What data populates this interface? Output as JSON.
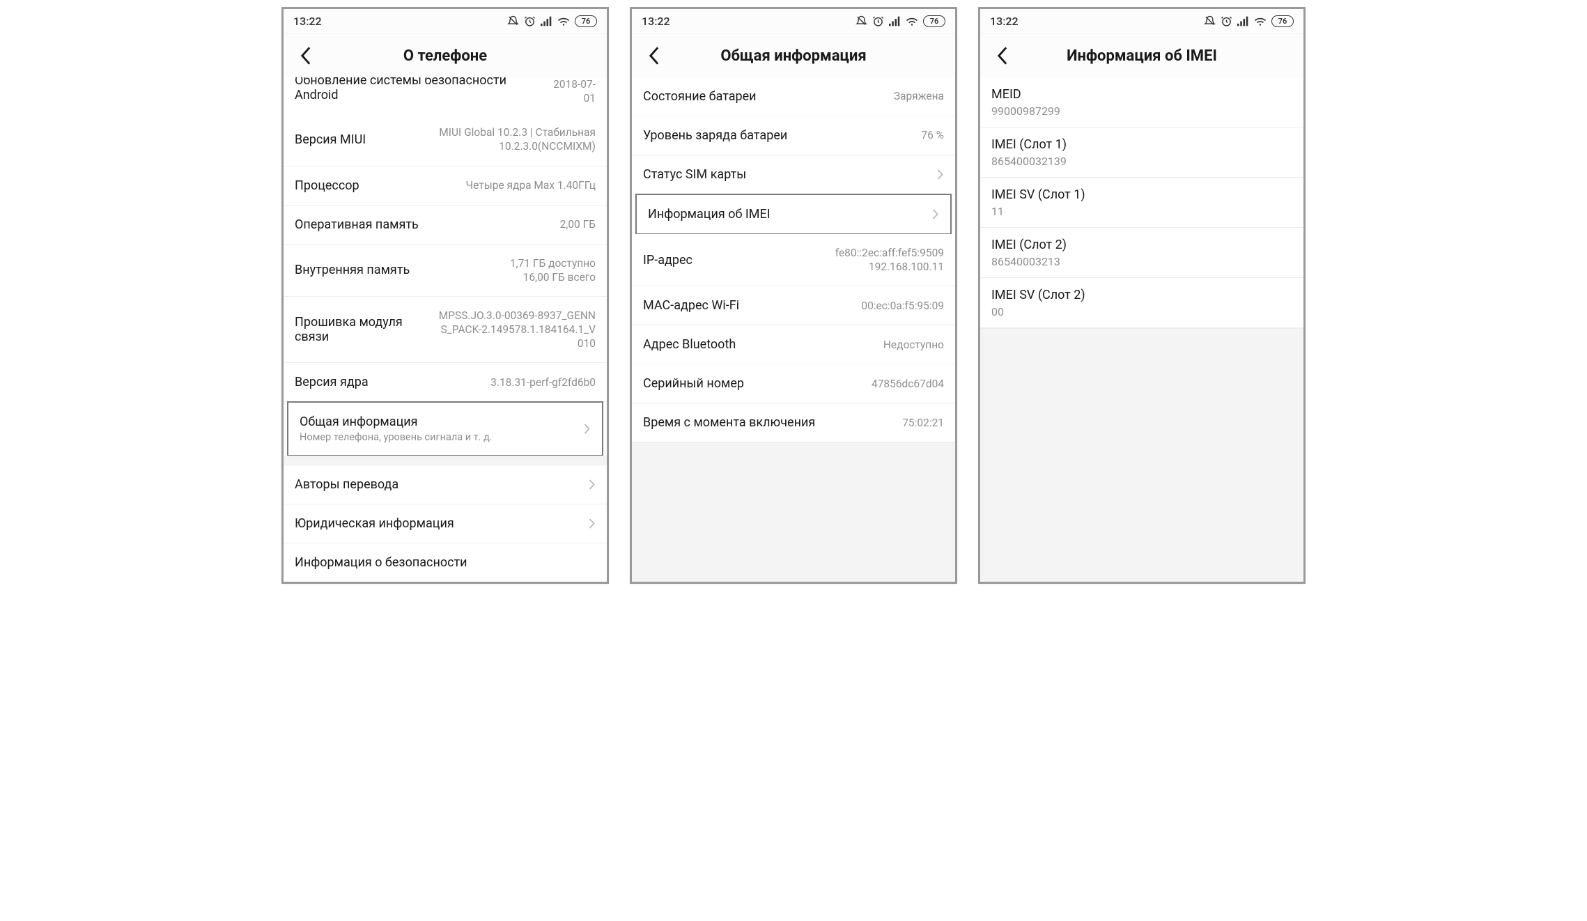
{
  "status": {
    "time": "13:22",
    "battery": "76"
  },
  "phone1": {
    "title": "О телефоне",
    "security_update": {
      "label": "Обновление системы безопасности Android",
      "value": "2018-07-01"
    },
    "miui": {
      "label": "Версия MIUI",
      "value": "MIUI Global 10.2.3 | Стабильная\n10.2.3.0(NCCMIXM)"
    },
    "cpu": {
      "label": "Процессор",
      "value": "Четыре ядра Max 1.40ГГц"
    },
    "ram": {
      "label": "Оперативная память",
      "value": "2,00 ГБ"
    },
    "storage": {
      "label": "Внутренняя память",
      "value": "1,71 ГБ доступно\n16,00 ГБ всего"
    },
    "baseband": {
      "label": "Прошивка модуля связи",
      "value": "MPSS.JO.3.0-00369-8937_GENNS_PACK-2.149578.1.184164.1_V010"
    },
    "kernel": {
      "label": "Версия ядра",
      "value": "3.18.31-perf-gf2fd6b0"
    },
    "status_sub": {
      "label": "Общая информация",
      "sub": "Номер телефона, уровень сигнала и т. д."
    },
    "translators": {
      "label": "Авторы перевода"
    },
    "legal": {
      "label": "Юридическая информация"
    },
    "safety": {
      "label": "Информация о безопасности"
    }
  },
  "phone2": {
    "title": "Общая информация",
    "batt_status": {
      "label": "Состояние батареи",
      "value": "Заряжена"
    },
    "batt_level": {
      "label": "Уровень заряда батареи",
      "value": "76 %"
    },
    "sim": {
      "label": "Статус SIM карты"
    },
    "imei": {
      "label": "Информация об IMEI"
    },
    "ip": {
      "label": "IP-адрес",
      "value": "fe80::2ec:aff:fef5:9509\n192.168.100.11"
    },
    "mac": {
      "label": "MAC-адрес Wi-Fi",
      "value": "00:ec:0a:f5:95:09"
    },
    "bt": {
      "label": "Адрес Bluetooth",
      "value": "Недоступно"
    },
    "serial": {
      "label": "Серийный номер",
      "value": "47856dc67d04"
    },
    "uptime": {
      "label": "Время с момента включения",
      "value": "75:02:21"
    }
  },
  "phone3": {
    "title": "Информация об IMEI",
    "meid": {
      "label": "MEID",
      "value": "99000987299"
    },
    "imei1": {
      "label": "IMEI (Слот 1)",
      "value": "865400032139"
    },
    "imeisv1": {
      "label": "IMEI SV (Слот 1)",
      "value": "11"
    },
    "imei2": {
      "label": "IMEI (Слот 2)",
      "value": "86540003213"
    },
    "imeisv2": {
      "label": "IMEI SV (Слот 2)",
      "value": "00"
    }
  }
}
